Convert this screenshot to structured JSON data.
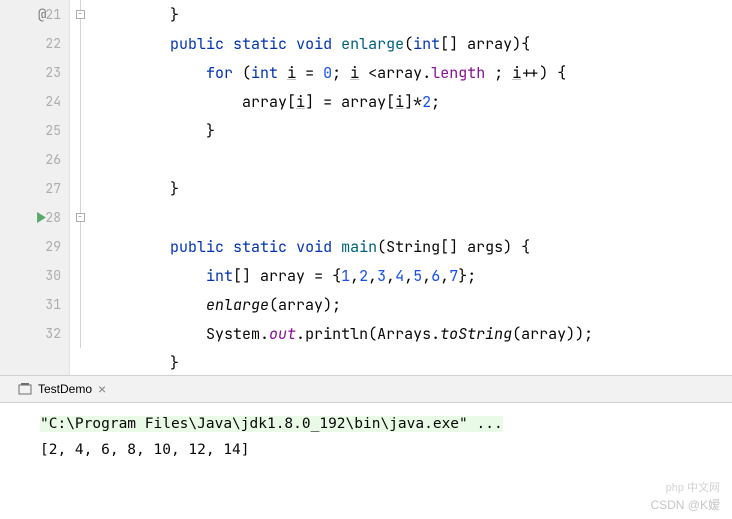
{
  "gutter": {
    "lines": [
      "21",
      "22",
      "23",
      "24",
      "25",
      "26",
      "27",
      "28",
      "29",
      "30",
      "31",
      "32"
    ],
    "change_marker": "@",
    "change_marker_line": 0,
    "run_marker_line": 7
  },
  "code": {
    "l20": {
      "ind1": "        ",
      "brace": "}"
    },
    "l21": {
      "ind1": "        ",
      "kw1": "public",
      "sp1": " ",
      "kw2": "static",
      "sp2": " ",
      "kw3": "void",
      "sp3": " ",
      "fn": "enlarge",
      "p1": "(",
      "kw4": "int",
      "arr": "[] ",
      "param": "array",
      "p2": "){"
    },
    "l22": {
      "ind1": "            ",
      "kw1": "for",
      "sp1": " (",
      "kw2": "int",
      "sp2": " ",
      "var1": "i",
      "eq": " = ",
      "num1": "0",
      "semi1": "; ",
      "var2": "i",
      "lt": " <",
      "param": "array",
      "dot": ".",
      "fld": "length",
      "sp3": " ; ",
      "var3": "i",
      "inc": "++) {"
    },
    "l23": {
      "ind1": "                ",
      "param": "array",
      "br1": "[",
      "var1": "i",
      "br2": "] = ",
      "param2": "array",
      "br3": "[",
      "var2": "i",
      "br4": "]*",
      "num": "2",
      "semi": ";"
    },
    "l24": {
      "ind1": "            ",
      "brace": "}"
    },
    "l25": {
      "ind1": ""
    },
    "l26": {
      "ind1": "        ",
      "brace": "}"
    },
    "l27": {
      "ind1": ""
    },
    "l28": {
      "ind1": "        ",
      "kw1": "public",
      "sp1": " ",
      "kw2": "static",
      "sp2": " ",
      "kw3": "void",
      "sp3": " ",
      "fn": "main",
      "p1": "(String[] ",
      "param": "args",
      "p2": ") {"
    },
    "l29": {
      "ind1": "            ",
      "kw1": "int",
      "arr": "[] ",
      "var": "array",
      "eq": " = {",
      "n1": "1",
      "c1": ",",
      "n2": "2",
      "c2": ",",
      "n3": "3",
      "c3": ",",
      "n4": "4",
      "c4": ",",
      "n5": "5",
      "c5": ",",
      "n6": "6",
      "c6": ",",
      "n7": "7",
      "end": "};"
    },
    "l30": {
      "ind1": "            ",
      "fn": "enlarge",
      "p1": "(",
      "var": "array",
      "p2": ");"
    },
    "l31": {
      "ind1": "            ",
      "cls": "System.",
      "fld": "out",
      "dot": ".",
      "m1": "println",
      "p1": "(Arrays.",
      "m2": "toString",
      "p2": "(",
      "var": "array",
      "p3": "));"
    },
    "l32": {
      "ind1": "        ",
      "brace": "}"
    }
  },
  "tab": {
    "name": "TestDemo",
    "close": "×"
  },
  "console": {
    "cmd": "\"C:\\Program Files\\Java\\jdk1.8.0_192\\bin\\java.exe\" ...",
    "output": "[2, 4, 6, 8, 10, 12, 14]"
  },
  "watermark": {
    "w1": "php 中文网",
    "w2": "CSDN @K嫒"
  }
}
